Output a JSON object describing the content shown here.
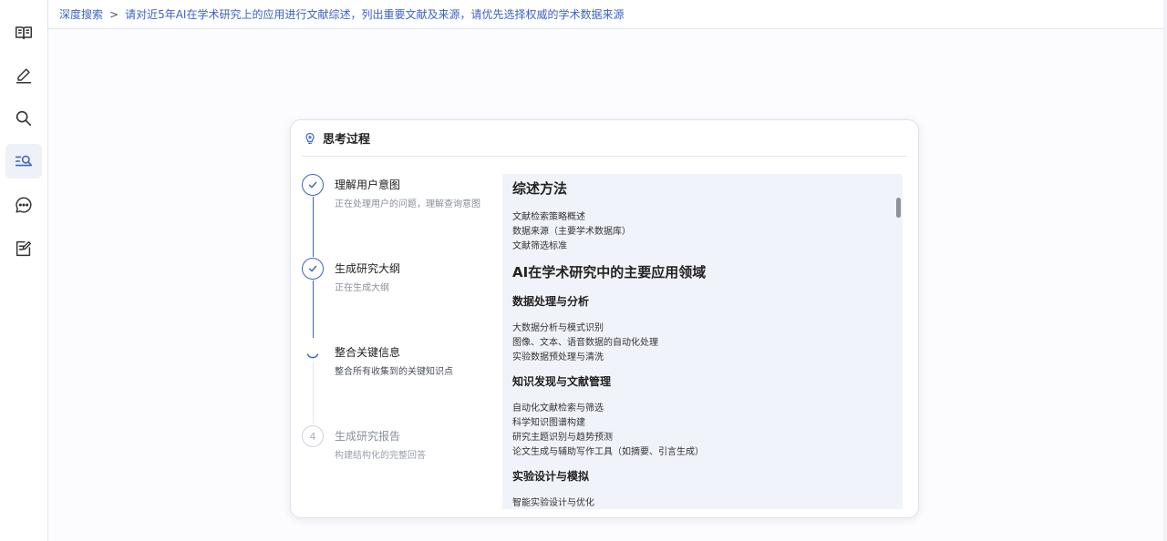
{
  "header": {
    "crumb_root": "深度搜索",
    "separator": ">",
    "crumb_current": "请对近5年AI在学术研究上的应用进行文献综述，列出重要文献及来源，请优先选择权威的学术数据来源"
  },
  "sidebar": {
    "items": [
      {
        "icon": "book-icon",
        "active": false
      },
      {
        "icon": "pen-icon",
        "active": false
      },
      {
        "icon": "search-icon",
        "active": false
      },
      {
        "icon": "deep-search-icon",
        "active": true
      },
      {
        "icon": "chat-bubble-icon",
        "active": false
      },
      {
        "icon": "note-edit-icon",
        "active": false
      }
    ]
  },
  "card": {
    "icon": "lightbulb-icon",
    "title": "思考过程",
    "steps": [
      {
        "status": "done",
        "title": "理解用户意图",
        "desc": "正在处理用户的问题，理解查询意图"
      },
      {
        "status": "done",
        "title": "生成研究大纲",
        "desc": "正在生成大纲"
      },
      {
        "status": "in-progress",
        "title": "整合关键信息",
        "desc": "整合所有收集到的关键知识点"
      },
      {
        "status": "pending",
        "number": "4",
        "title": "生成研究报告",
        "desc": "构建结构化的完整回答"
      }
    ]
  },
  "outline": {
    "sec1_title": "综述方法",
    "sec1_items": [
      "文献检索策略概述",
      "数据来源（主要学术数据库）",
      "文献筛选标准"
    ],
    "sec2_title": "AI在学术研究中的主要应用领域",
    "sub1_title": "数据处理与分析",
    "sub1_items": [
      "大数据分析与模式识别",
      "图像、文本、语音数据的自动化处理",
      "实验数据预处理与清洗"
    ],
    "sub2_title": "知识发现与文献管理",
    "sub2_items": [
      "自动化文献检索与筛选",
      "科学知识图谱构建",
      "研究主题识别与趋势预测",
      "论文生成与辅助写作工具（如摘要、引言生成）"
    ],
    "sub3_title": "实验设计与模拟",
    "sub3_items": [
      "智能实验设计与优化"
    ]
  },
  "colors": {
    "accent": "#3b63c4",
    "pane_bg": "#f1f3fa",
    "muted_text": "#8a8f99"
  }
}
